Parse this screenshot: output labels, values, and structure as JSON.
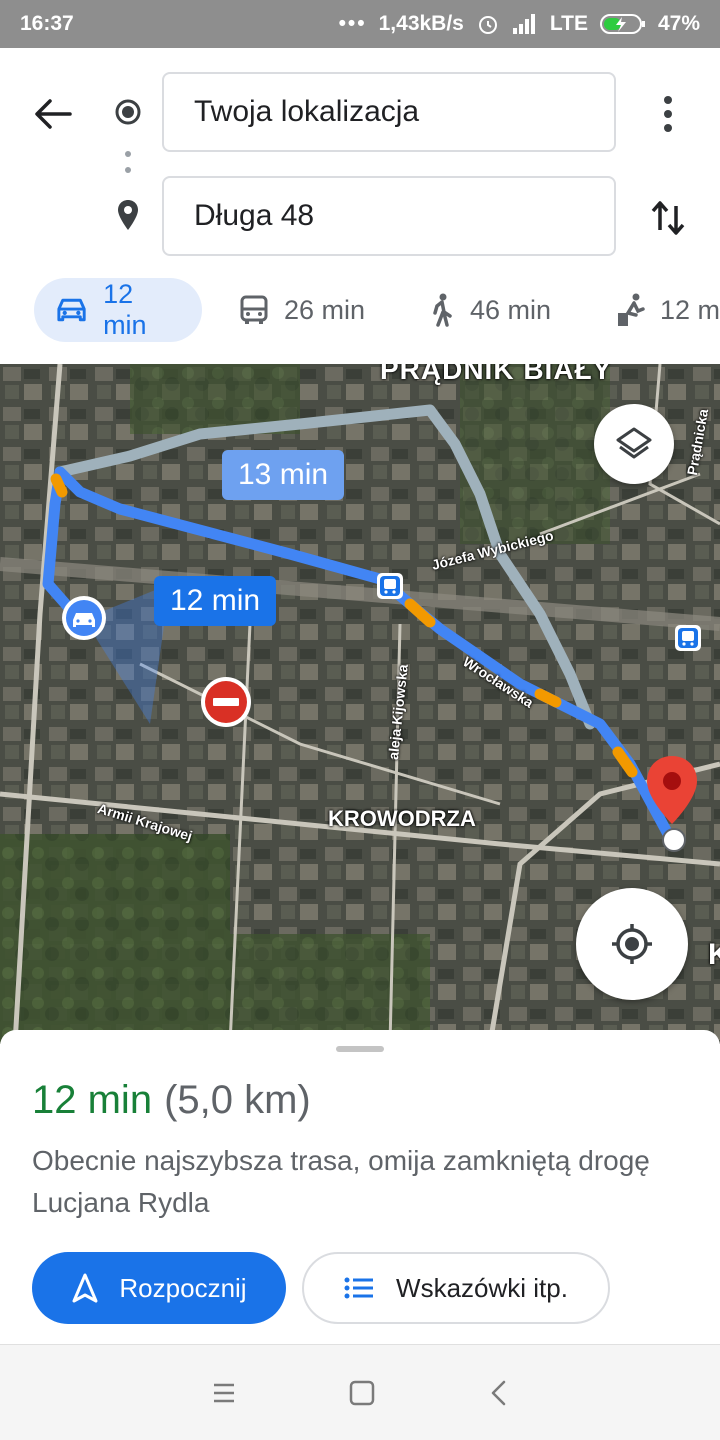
{
  "status_bar": {
    "time": "16:37",
    "dots": "•••",
    "speed": "1,43kB/s",
    "network": "LTE",
    "battery": "47%"
  },
  "directions": {
    "origin": "Twoja lokalizacja",
    "destination": "Długa 48"
  },
  "modes": [
    {
      "icon": "car-icon",
      "label": "12 min",
      "active": true
    },
    {
      "icon": "bus-icon",
      "label": "26 min",
      "active": false
    },
    {
      "icon": "walk-icon",
      "label": "46 min",
      "active": false
    },
    {
      "icon": "ride-icon",
      "label": "12 m",
      "active": false
    }
  ],
  "map": {
    "district_top": "PRĄDNIK BIAŁY",
    "district_mid": "KROWODRZA",
    "street_wybickiego": "Józefa Wybickiego",
    "street_wroclawska": "Wrocławska",
    "street_kijowska": "aleja Kijowska",
    "street_armii": "Armii Krajowej",
    "street_pradnicka": "Prądnicka",
    "edge_letter": "K",
    "alt_route_time": "13 min",
    "main_route_time": "12 min",
    "route_color": "#4285f4",
    "alt_route_color": "#9fb1bb",
    "traffic_color": "#f29900",
    "pin_color": "#ea4335"
  },
  "sheet": {
    "duration": "12 min",
    "distance": "(5,0 km)",
    "description": "Obecnie najszybsza trasa, omija zamkniętą drogę Lucjana Rydla",
    "start_label": "Rozpocznij",
    "steps_label": "Wskazówki itp."
  }
}
